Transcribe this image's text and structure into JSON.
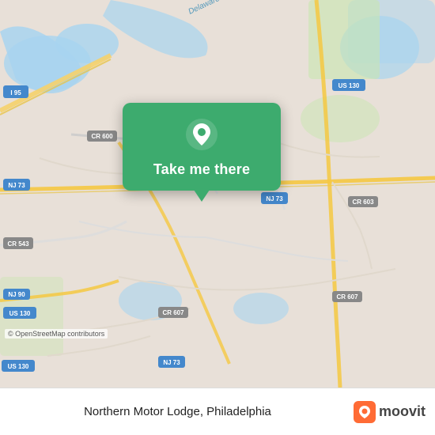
{
  "map": {
    "attribution": "© OpenStreetMap contributors",
    "background_color": "#e8e0d8"
  },
  "popup": {
    "button_label": "Take me there",
    "location_icon": "map-pin"
  },
  "bottom_bar": {
    "location_name": "Northern Motor Lodge, Philadelphia",
    "moovit_label": "moovit"
  },
  "roads": {
    "labels": [
      "I 95",
      "NJ 73",
      "US 130",
      "NJ 90",
      "US 130",
      "CR 600",
      "CR 607",
      "CR 607",
      "CR 603",
      "US 130",
      "Delaware R"
    ]
  }
}
